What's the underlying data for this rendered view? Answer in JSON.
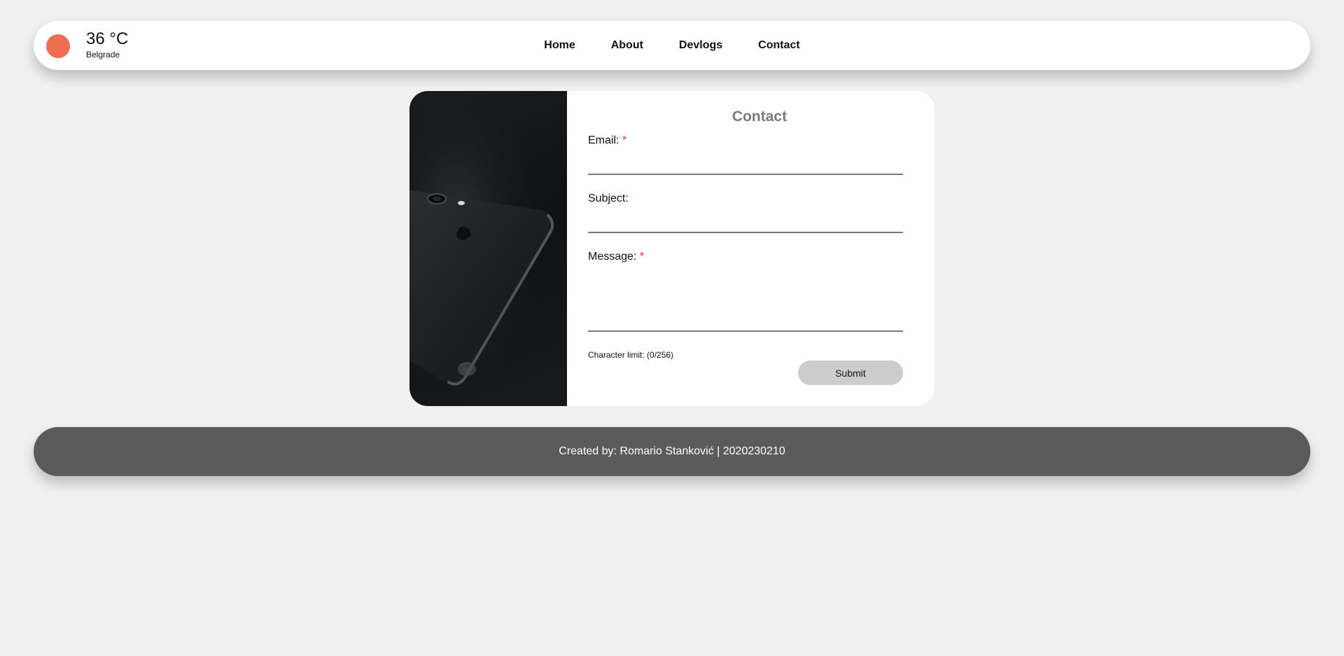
{
  "header": {
    "weather": {
      "temperature": "36 °C",
      "city": "Belgrade",
      "indicator_color": "#ee6e52"
    },
    "nav": [
      "Home",
      "About",
      "Devlogs",
      "Contact"
    ]
  },
  "contact_form": {
    "image_icon": "smartphone-photo",
    "title": "Contact",
    "email_label": "Email:",
    "subject_label": "Subject:",
    "message_label": "Message:",
    "required_marker": "*",
    "email_value": "",
    "subject_value": "",
    "message_value": "",
    "char_limit": "Character limit: (0/256)",
    "submit_label": "Submit"
  },
  "footer": {
    "text": "Created by: Romario Stanković | 2020230210"
  }
}
